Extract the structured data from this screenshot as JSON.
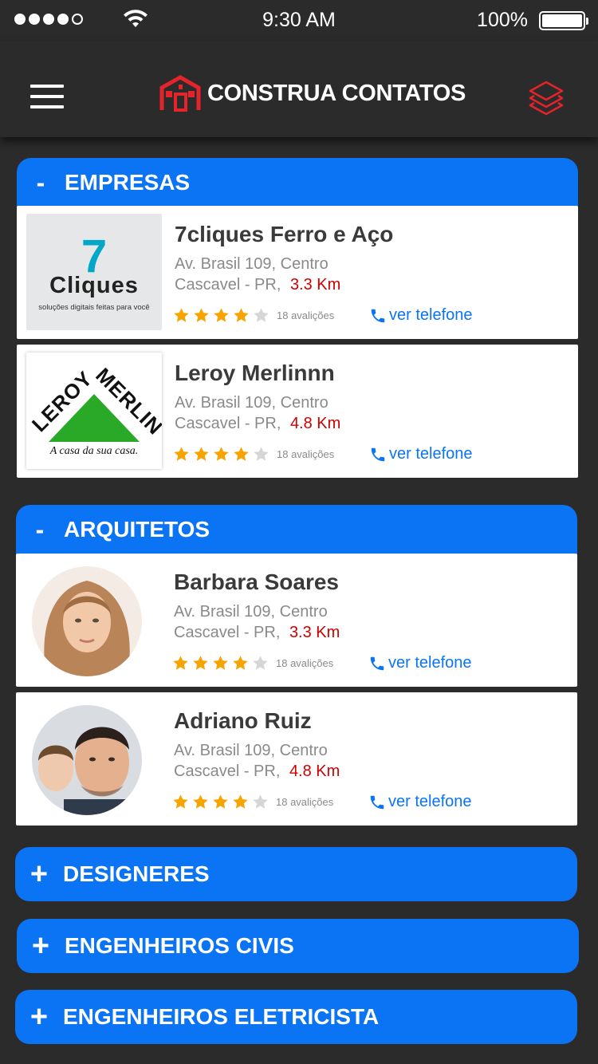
{
  "status": {
    "time": "9:30 AM",
    "battery": "100%"
  },
  "header": {
    "title": "CONSTRUA CONTATOS",
    "menu_icon": "hamburger-icon",
    "layers_icon": "layers-icon"
  },
  "colors": {
    "accent": "#0b74f5",
    "brand_red": "#e4232b",
    "distance_red": "#d00000",
    "star": "#f7a300"
  },
  "sections": [
    {
      "title": "EMPRESAS",
      "sign": "-",
      "expanded": true,
      "items": [
        {
          "name": "7cliques Ferro e Aço",
          "address": "Av. Brasil 109, Centro",
          "city": "Cascavel - PR,",
          "distance": "3.3 Km",
          "rating": 4,
          "reviews": "18 avalições",
          "phone_label": "ver telefone",
          "logo_text": "Cliques",
          "logo_digit": "7",
          "logo_tagline": "soluções digitais feitas para você"
        },
        {
          "name": "Leroy Merlinnn",
          "address": "Av. Brasil 109, Centro",
          "city": "Cascavel - PR,",
          "distance": "4.8 Km",
          "rating": 4,
          "reviews": "18 avalições",
          "phone_label": "ver telefone",
          "logo_text_left": "LEROY",
          "logo_text_right": "MERLIN",
          "logo_tagline": "A casa da sua casa."
        }
      ]
    },
    {
      "title": "ARQUITETOS",
      "sign": "-",
      "expanded": true,
      "items": [
        {
          "name": "Barbara Soares",
          "address": "Av. Brasil 109, Centro",
          "city": "Cascavel - PR,",
          "distance": "3.3 Km",
          "rating": 4,
          "reviews": "18 avalições",
          "phone_label": "ver telefone"
        },
        {
          "name": "Adriano Ruiz",
          "address": "Av. Brasil 109, Centro",
          "city": "Cascavel - PR,",
          "distance": "4.8 Km",
          "rating": 4,
          "reviews": "18 avalições",
          "phone_label": "ver telefone"
        }
      ]
    },
    {
      "title": "DESIGNERES",
      "sign": "+",
      "expanded": false
    },
    {
      "title": "ENGENHEIROS CIVIS",
      "sign": "+",
      "expanded": false
    },
    {
      "title": "ENGENHEIROS ELETRICISTA",
      "sign": "+",
      "expanded": false
    }
  ]
}
